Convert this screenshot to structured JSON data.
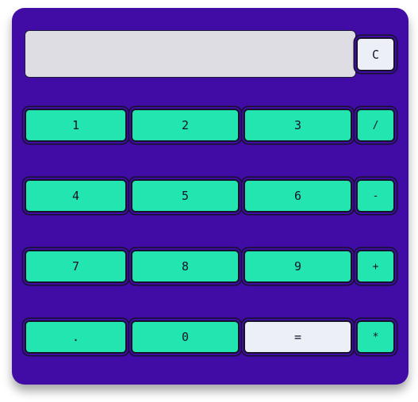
{
  "display": {
    "value": ""
  },
  "keys": {
    "clear": "C",
    "one": "1",
    "two": "2",
    "three": "3",
    "divide": "/",
    "four": "4",
    "five": "5",
    "six": "6",
    "minus": "-",
    "seven": "7",
    "eight": "8",
    "nine": "9",
    "plus": "+",
    "decimal": ".",
    "zero": "0",
    "equals": "=",
    "multiply": "*"
  },
  "colors": {
    "body": "#410ba6",
    "key": "#22e5b0",
    "key_light": "#eceff6",
    "display": "#dedde4",
    "outline": "#15122a"
  }
}
